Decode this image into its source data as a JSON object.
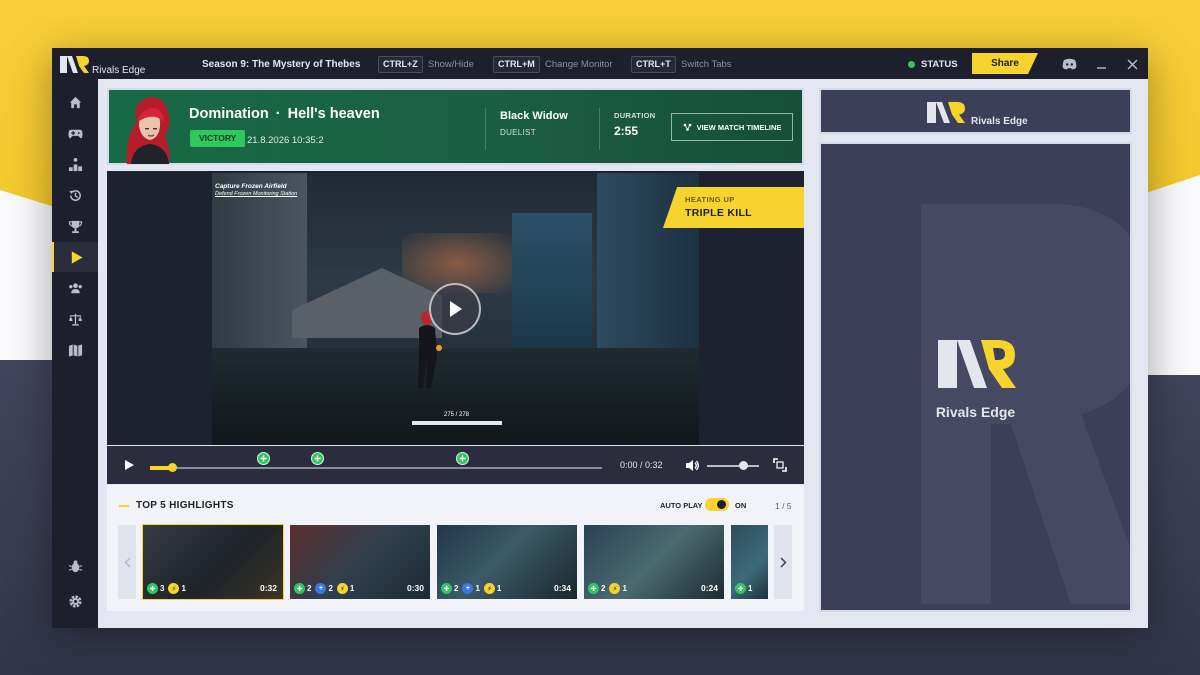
{
  "app": {
    "name": "Rivals Edge",
    "season": "Season 9: The Mystery of Thebes",
    "shortcuts": [
      {
        "key": "CTRL+Z",
        "label": "Show/Hide"
      },
      {
        "key": "CTRL+M",
        "label": "Change Monitor"
      },
      {
        "key": "CTRL+T",
        "label": "Switch Tabs"
      }
    ],
    "status_label": "STATUS",
    "share_label": "Share"
  },
  "sidebar": {
    "items": [
      {
        "icon": "home-icon"
      },
      {
        "icon": "gamepad-icon"
      },
      {
        "icon": "leaderboard-icon"
      },
      {
        "icon": "history-icon"
      },
      {
        "icon": "trophy-icon"
      },
      {
        "icon": "play-icon",
        "active": true
      },
      {
        "icon": "team-icon"
      },
      {
        "icon": "balance-icon"
      },
      {
        "icon": "map-icon"
      }
    ],
    "bottom": [
      {
        "icon": "bug-icon"
      },
      {
        "icon": "gear-icon"
      }
    ]
  },
  "match": {
    "mode": "Domination",
    "map": "Hell's heaven",
    "separator": "·",
    "result": "VICTORY",
    "date": "21.8.2026 10:35:2",
    "hero": "Black Widow",
    "role": "DUELIST",
    "duration_label": "DURATION",
    "duration": "2:55",
    "timeline_button": "VIEW MATCH TIMELINE"
  },
  "video": {
    "objective": "Capture Frozen Airfield",
    "objective_sub": "Defend Frozen Monitoring Station",
    "hud_ammo": "275 / 278",
    "badge_sub": "HEATING UP",
    "badge_main": "TRIPLE KILL",
    "time": "0:00 / 0:32",
    "progress": 0.03,
    "volume": 0.7,
    "markers": [
      0.25,
      0.37,
      0.69
    ]
  },
  "highlights": {
    "title": "TOP 5 HIGHLIGHTS",
    "autoplay_label": "AUTO PLAY",
    "autoplay_state": "ON",
    "page": "1 / 5",
    "items": [
      {
        "stats": [
          {
            "type": "g",
            "value": "3"
          },
          {
            "type": "y",
            "value": "1"
          }
        ],
        "duration": "0:32",
        "active": true
      },
      {
        "stats": [
          {
            "type": "g",
            "value": "2"
          },
          {
            "type": "b",
            "value": "2"
          },
          {
            "type": "y",
            "value": "1"
          }
        ],
        "duration": "0:30"
      },
      {
        "stats": [
          {
            "type": "g",
            "value": "2"
          },
          {
            "type": "b",
            "value": "1"
          },
          {
            "type": "y",
            "value": "1"
          }
        ],
        "duration": "0:34"
      },
      {
        "stats": [
          {
            "type": "g",
            "value": "2"
          },
          {
            "type": "y",
            "value": "1"
          }
        ],
        "duration": "0:24"
      },
      {
        "stats": [
          {
            "type": "g",
            "value": "1"
          }
        ],
        "duration": ""
      }
    ]
  },
  "ad": {
    "brand_top": "Rivals Edge",
    "brand_main": "Rivals Edge"
  }
}
